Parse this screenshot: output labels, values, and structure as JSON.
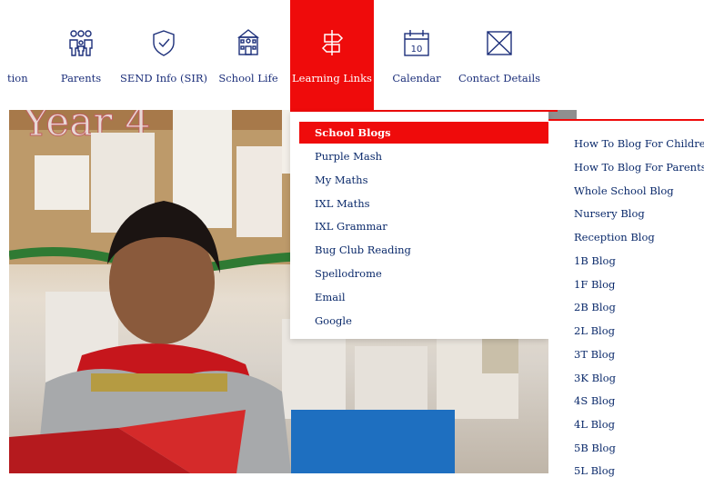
{
  "nav": {
    "items": [
      {
        "label": "tion",
        "icon": "info-icon"
      },
      {
        "label": "Parents",
        "icon": "family-icon"
      },
      {
        "label": "SEND Info (SIR)",
        "icon": "shield-check-icon"
      },
      {
        "label": "School Life",
        "icon": "school-building-icon"
      },
      {
        "label": "Learning Links",
        "icon": "signpost-icon",
        "active": true
      },
      {
        "label": "Calendar",
        "icon": "calendar-icon",
        "badge": "10"
      },
      {
        "label": "Contact Details",
        "icon": "envelope-icon"
      }
    ]
  },
  "dropdown": {
    "items": [
      "School Blogs",
      "Purple Mash",
      "My Maths",
      "IXL Maths",
      "IXL Grammar",
      "Bug Club Reading",
      "Spellodrome",
      "Email",
      "Google"
    ],
    "active_index": 0
  },
  "submenu": {
    "items": [
      "How To Blog For Children",
      "How To Blog For Parents",
      "Whole School Blog",
      "Nursery Blog",
      "Reception Blog",
      "1B Blog",
      "1F Blog",
      "2B Blog",
      "2L Blog",
      "3T Blog",
      "3K Blog",
      "4S Blog",
      "4L Blog",
      "5B Blog",
      "5L Blog"
    ]
  },
  "photo": {
    "wall_text": "Year 4"
  },
  "colors": {
    "accent": "#ef0b0b",
    "nav_text": "#1c2f7a",
    "link_text": "#0b2a6b"
  }
}
